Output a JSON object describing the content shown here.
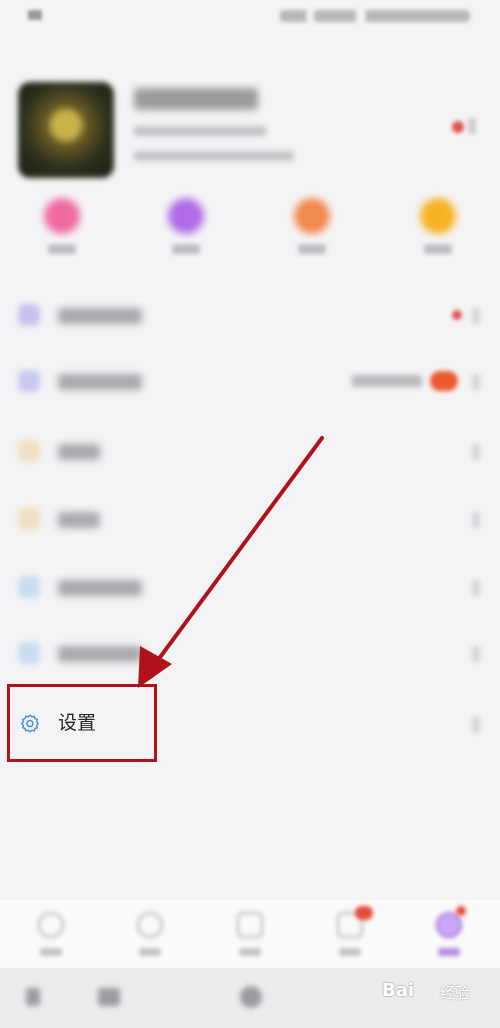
{
  "colors": {
    "background": "#f4f4f6",
    "highlight_box": "#b0121c",
    "settings_icon": "#4a90d9",
    "notification_red": "#e05050"
  },
  "quick_actions": [
    {
      "icon": "heart-icon",
      "color": "#f06aa0"
    },
    {
      "icon": "star-icon",
      "color": "#b06be8"
    },
    {
      "icon": "coin-icon",
      "color": "#f38a4f"
    },
    {
      "icon": "smile-icon",
      "color": "#f5b324"
    }
  ],
  "menu": {
    "settings_label": "设置",
    "settings_icon": "gear-icon"
  },
  "tab_bar": {
    "icons": [
      "home-icon",
      "discover-icon",
      "video-icon",
      "message-icon",
      "profile-icon"
    ]
  },
  "watermark": {
    "brand": "Bai",
    "suffix": "经验"
  }
}
